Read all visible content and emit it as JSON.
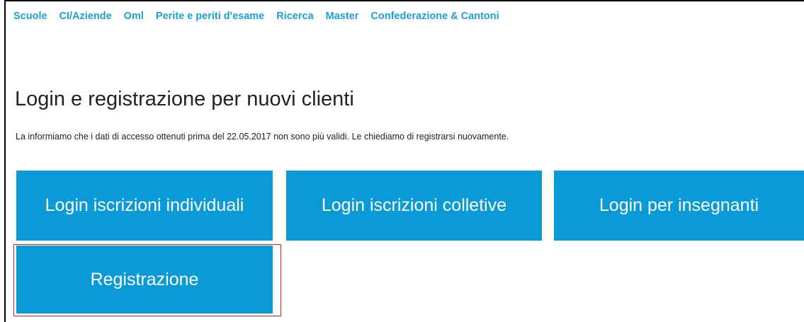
{
  "nav": {
    "items": [
      {
        "label": "Scuole"
      },
      {
        "label": "CI/Aziende"
      },
      {
        "label": "Oml"
      },
      {
        "label": "Perite e periti d'esame"
      },
      {
        "label": "Ricerca"
      },
      {
        "label": "Master"
      },
      {
        "label": "Confederazione & Cantoni"
      }
    ]
  },
  "page": {
    "title": "Login e registrazione per nuovi clienti",
    "notice": "La informiamo che i dati di accesso ottenuti prima del 22.05.2017 non sono più validi. Le chiediamo di registrarsi nuovamente."
  },
  "tiles": {
    "individual": "Login iscrizioni individuali",
    "collective": "Login iscrizioni colletive",
    "teachers": "Login per insegnanti",
    "register": "Registrazione"
  },
  "colors": {
    "accent": "#0a9ad8",
    "nav_link": "#1a9fda",
    "highlight": "#d0202e"
  }
}
